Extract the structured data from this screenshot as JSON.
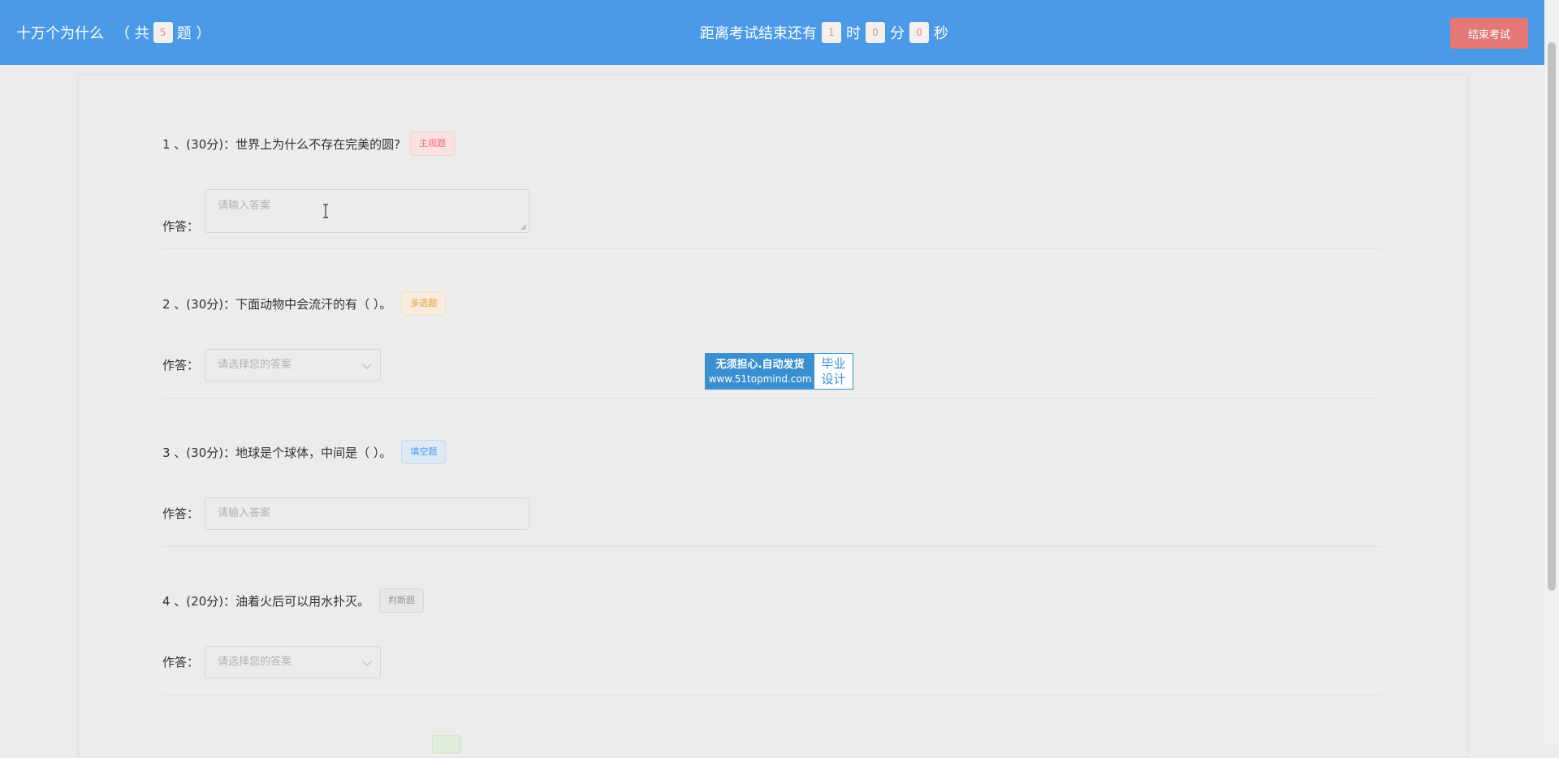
{
  "header": {
    "title": "十万个为什么",
    "count_prefix": "（ 共",
    "count": "5",
    "count_suffix": "题 ）",
    "countdown_label": "距离考试结束还有",
    "hours": "1",
    "hours_unit": "时",
    "minutes": "0",
    "minutes_unit": "分",
    "seconds": "0",
    "seconds_unit": "秒",
    "end_button": "结束考试"
  },
  "answer_label": "作答：",
  "questions": [
    {
      "title": "1 、(30分)：世界上为什么不存在完美的圆?",
      "tag": "主观题",
      "placeholder": "请输入答案"
    },
    {
      "title": "2 、(30分)：下面动物中会流汗的有（ ）。",
      "tag": "多选题",
      "placeholder": "请选择您的答案"
    },
    {
      "title": "3 、(30分)：地球是个球体，中间是（ ）。",
      "tag": "填空题",
      "placeholder": "请输入答案"
    },
    {
      "title": "4 、(20分)：油着火后可以用水扑灭。",
      "tag": "判断题",
      "placeholder": "请选择您的答案"
    }
  ],
  "watermark": {
    "line1": "无须担心.自动发货",
    "line2": "www.51topmind.com",
    "right1": "毕业",
    "right2": "设计"
  },
  "icons": {
    "dropdown": "chevron-down-icon",
    "cursor": "text-cursor-icon"
  },
  "colors": {
    "header_bg": "#4a9ae8",
    "end_button": "#e47876",
    "tag_subjective": "#f56c6c",
    "tag_multi": "#e6a23c",
    "tag_fill": "#409eff",
    "tag_judge": "#909399"
  }
}
